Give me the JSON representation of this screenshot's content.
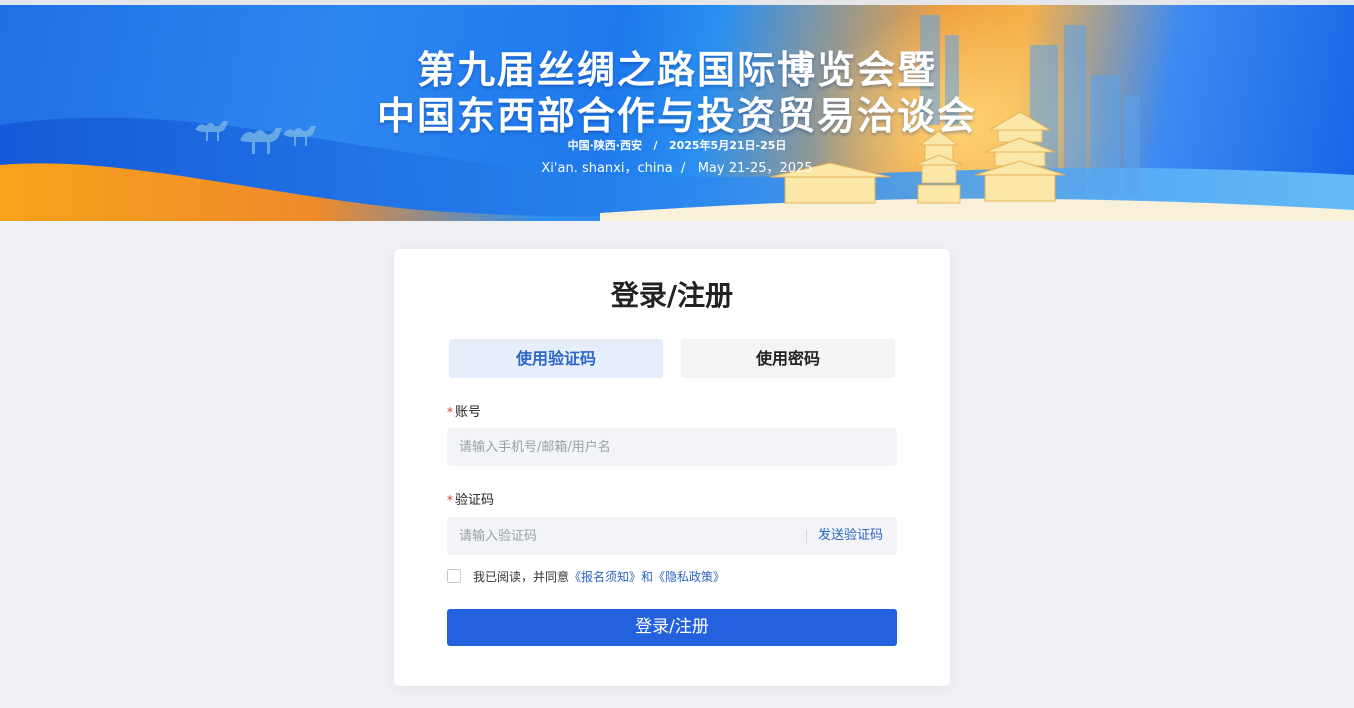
{
  "banner": {
    "title_line1": "第九届丝绸之路国际博览会暨",
    "title_line2": "中国东西部合作与投资贸易洽谈会",
    "subtitle_cn": "中国·陕西·西安   /   2025年5月21日-25日",
    "subtitle_en": "Xi'an. shanxi，china  /   May 21-25，2025"
  },
  "login": {
    "title": "登录/注册",
    "tabs": [
      {
        "label": "使用验证码",
        "active": true
      },
      {
        "label": "使用密码",
        "active": false
      }
    ],
    "account": {
      "required_mark": "*",
      "label": "账号",
      "placeholder": "请输入手机号/邮箱/用户名",
      "value": ""
    },
    "code": {
      "required_mark": "*",
      "label": "验证码",
      "placeholder": "请输入验证码",
      "value": "",
      "send_label": "发送验证码"
    },
    "agreement": {
      "checked": false,
      "text": "我已阅读，并同意",
      "link1": "《报名须知》",
      "and": "和",
      "link2": "《隐私政策》"
    },
    "submit_label": "登录/注册"
  },
  "colors": {
    "primary": "#2461de",
    "link": "#2a66c4",
    "required": "#e0312b",
    "page_bg": "#eef0f4"
  }
}
